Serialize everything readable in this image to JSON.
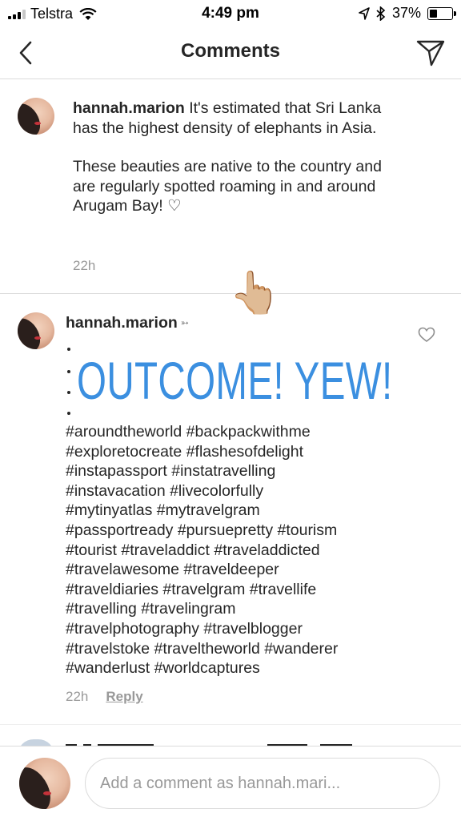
{
  "status_bar": {
    "carrier": "Telstra",
    "time": "4:49 pm",
    "battery_percent": "37%",
    "battery_level": 0.37,
    "signal_bars_active": 3,
    "icons": [
      "signal-icon",
      "wifi-icon",
      "location-arrow-icon",
      "bluetooth-icon",
      "battery-icon"
    ]
  },
  "nav": {
    "title": "Comments",
    "back_icon": "chevron-left-icon",
    "share_icon": "direct-message-icon"
  },
  "comments": [
    {
      "username": "hannah.marion",
      "paragraphs": [
        "It's estimated that Sri Lanka has the highest density of elephants in Asia.",
        "These beauties are native to the country and are regularly spotted roaming in and around Arugam Bay! ♡"
      ],
      "time": "22h"
    },
    {
      "username": "hannah.marion",
      "username_suffix": "➳",
      "emoji": "👆🏼",
      "big_text": "OUTCOME! YEW!",
      "hashtag_lines": [
        "#aroundtheworld #backpackwithme",
        "#exploretocreate #flashesofdelight",
        "#instapassport #instatravelling",
        "#instavacation #livecolorfully",
        "#mytinyatlas #mytravelgram",
        "#passportready #pursuepretty #tourism",
        "#tourist #traveladdict #traveladdicted",
        "#travelawesome #traveldeeper",
        "#traveldiaries #travelgram #travellife",
        "#travelling #travelingram",
        "#travelphotography #travelblogger",
        "#travelstoke #traveltheworld #wanderer",
        "#wanderlust #worldcaptures"
      ],
      "time": "22h",
      "reply_label": "Reply",
      "like_icon": "heart-outline-icon"
    }
  ],
  "composer": {
    "placeholder": "Add a comment as hannah.mari...",
    "value": ""
  },
  "colors": {
    "accent_text": "#3b8fe0",
    "text": "#262626",
    "muted": "#999999",
    "divider": "#dbdbdb"
  }
}
